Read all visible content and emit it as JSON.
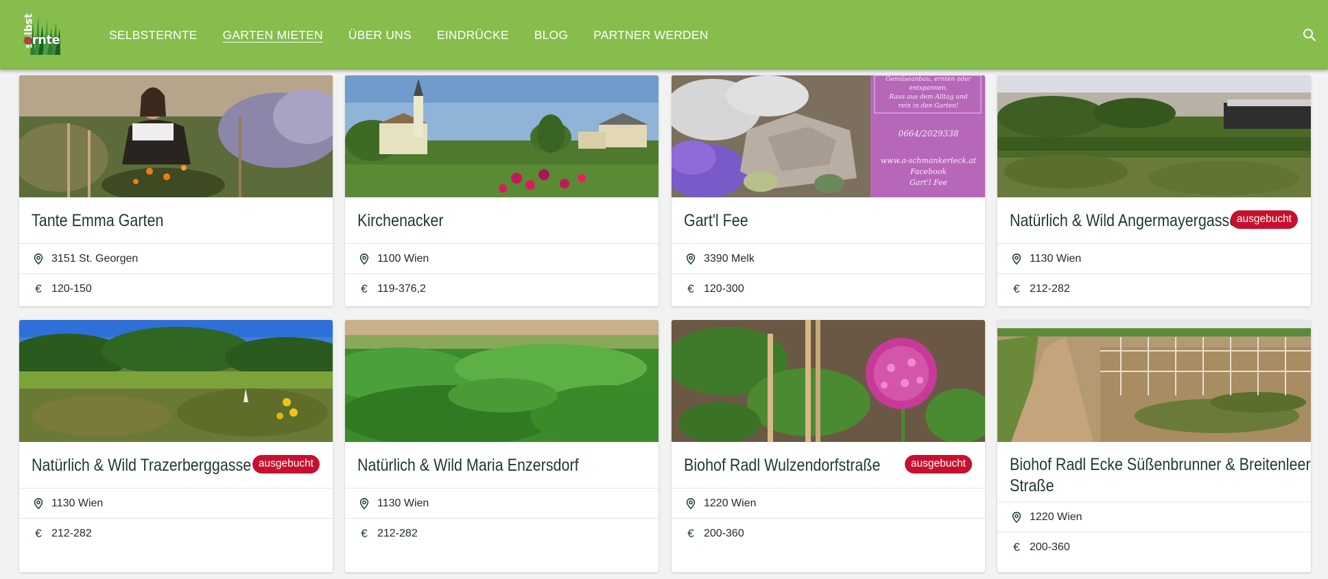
{
  "header": {
    "logo_text_vertical": "selbst",
    "logo_text_main_first": "e",
    "logo_text_main_rest": "rnte",
    "nav": [
      {
        "label": "SELBSTERNTE",
        "active": false
      },
      {
        "label": "GARTEN MIETEN",
        "active": true
      },
      {
        "label": "ÜBER UNS",
        "active": false
      },
      {
        "label": "EINDRÜCKE",
        "active": false
      },
      {
        "label": "BLOG",
        "active": false
      },
      {
        "label": "PARTNER WERDEN",
        "active": false
      }
    ],
    "search_icon": "search-icon",
    "colors": {
      "bar": "#86bd4d",
      "badge": "#c8102e",
      "title": "#1e3a2f"
    }
  },
  "cards": [
    {
      "title": "Tante Emma Garten",
      "badge": "",
      "location": "3151 St. Georgen",
      "price": "120-150",
      "currency": "€"
    },
    {
      "title": "Kirchenacker",
      "badge": "",
      "location": "1100 Wien",
      "price": "119-376,2",
      "currency": "€"
    },
    {
      "title": "Gart'l Fee",
      "badge": "",
      "location": "3390 Melk",
      "price": "120-300",
      "currency": "€"
    },
    {
      "title": "Natürlich & Wild Angermayergasse",
      "badge": "ausgebucht",
      "location": "1130 Wien",
      "price": "212-282",
      "currency": "€"
    },
    {
      "title": "Natürlich & Wild Trazerberggasse",
      "badge": "ausgebucht",
      "location": "1130 Wien",
      "price": "212-282",
      "currency": "€"
    },
    {
      "title": "Natürlich & Wild Maria Enzersdorf",
      "badge": "",
      "location": "1130 Wien",
      "price": "212-282",
      "currency": "€"
    },
    {
      "title": "Biohof Radl Wulzendorfstraße",
      "badge": "ausgebucht",
      "location": "1220 Wien",
      "price": "200-360",
      "currency": "€"
    },
    {
      "title_line1": "Biohof Radl Ecke Süßenbrunner & Breitenleer",
      "title_line2": "Straße",
      "badge": "",
      "location": "1220 Wien",
      "price": "200-360",
      "currency": "€"
    }
  ],
  "gartl_fee_sign": {
    "lines": [
      "Gemüseanbau, ernten oder",
      "entspannen.",
      "Raus aus dem Alltag und",
      "rein in den Garten!",
      "0664/2029338",
      "www.a-schmankerleck.at",
      "Facebook",
      "Gart'l Fee"
    ]
  }
}
